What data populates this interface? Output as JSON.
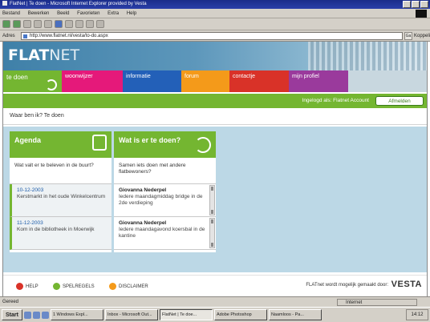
{
  "browser": {
    "title": "FlatNet | Te doen - Microsoft Internet Explorer provided by Vesta",
    "menu": [
      "Bestand",
      "Bewerken",
      "Beeld",
      "Favorieten",
      "Extra",
      "Help"
    ],
    "address_label": "Adres",
    "address_value": "http://www.flatnet.nl/vesta/to-do.aspx",
    "go_label": "Ga",
    "links_label": "Koppelingen"
  },
  "site": {
    "logo_flat": "FLAT",
    "logo_net": "NET",
    "nav": [
      {
        "label": "te doen"
      },
      {
        "label": "woonwijzer"
      },
      {
        "label": "informatie"
      },
      {
        "label": "forum"
      },
      {
        "label": "contactje"
      },
      {
        "label": "mijn profiel"
      }
    ],
    "login_message": "Ingelogd als: Flatnet Account",
    "logout_label": "Afmelden",
    "breadcrumb": "Waar ben ik? Te doen",
    "agenda": {
      "title": "Agenda",
      "intro": "Wat valt er te beleven in de buurt?",
      "items": [
        {
          "date": "10-12-2003",
          "text": "Kerstmarkt in het oude Winkelcentrum"
        },
        {
          "date": "11-12-2003",
          "text": "Kom in de bibliotheek in Moerwijk"
        }
      ]
    },
    "todo": {
      "title": "Wat is er te doen?",
      "intro": "Samen iets doen met andere flatbewoners?",
      "items": [
        {
          "author": "Giovanna Nederpel",
          "text": "Iedere maandagmiddag bridge in de 2de verdieping"
        },
        {
          "author": "Giovanna Nederpel",
          "text": "Iedere maandagavond koersbal in de kantine"
        }
      ]
    },
    "footer": {
      "links": [
        {
          "label": "HELP",
          "color": "#d93228"
        },
        {
          "label": "SPELREGELS",
          "color": "#74b631"
        },
        {
          "label": "DISCLAIMER",
          "color": "#f49a1a"
        }
      ],
      "note": "FLATnet wordt mogelijk gemaakt door:",
      "sponsor": "VESTA"
    }
  },
  "status": {
    "text": "Gereed",
    "zone": "Internet"
  },
  "taskbar": {
    "start": "Start",
    "tasks": [
      "1 Windows Expl...",
      "Inbox - Microsoft Out...",
      "FlatNet | Te doe...",
      "Adobe Photoshop",
      "Naamloos - Pa..."
    ],
    "clock": "14:12"
  },
  "colors": {
    "green": "#74b631",
    "pink": "#e5197a",
    "blue": "#2360b8",
    "orange": "#f49a1a",
    "red": "#d93228",
    "purple": "#9a3a9c",
    "content_bg": "#bcd8e6"
  }
}
